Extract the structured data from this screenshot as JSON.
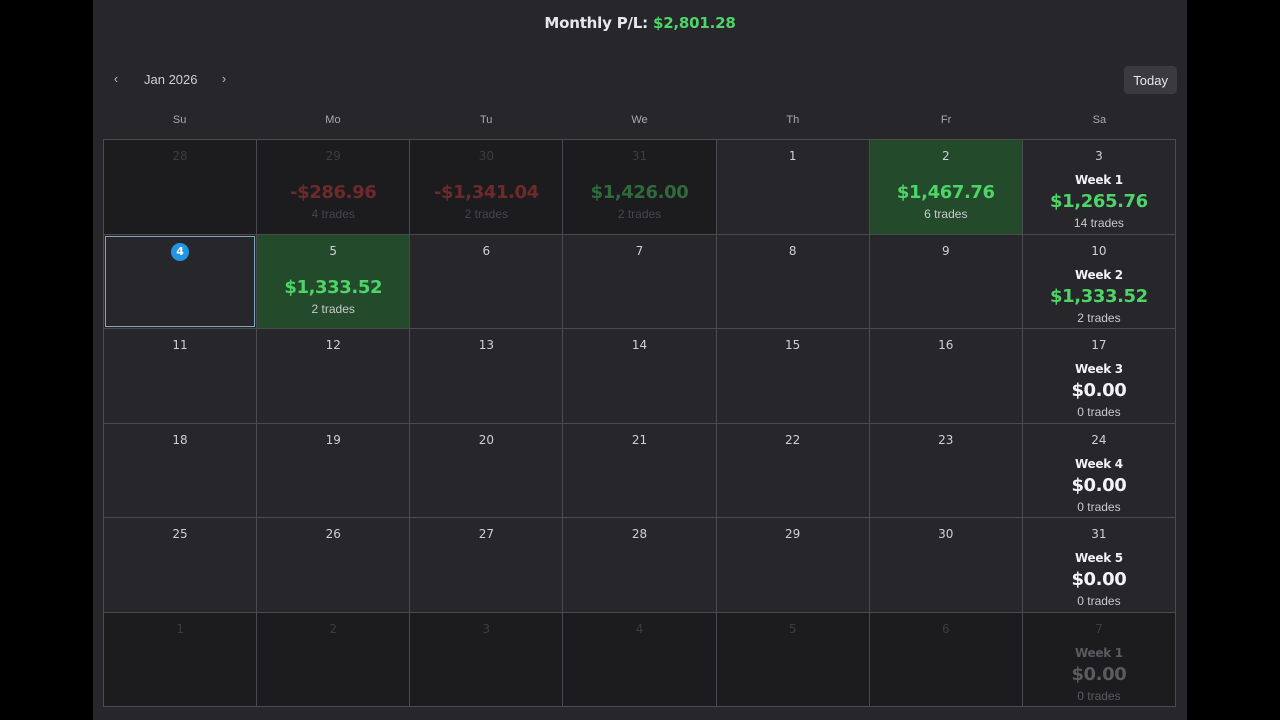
{
  "header": {
    "label": "Monthly P/L:",
    "value": "$2,801.28"
  },
  "nav": {
    "prev": "‹",
    "next": "›",
    "month": "Jan 2026",
    "today": "Today"
  },
  "weekdays": [
    "Su",
    "Mo",
    "Tu",
    "We",
    "Th",
    "Fr",
    "Sa"
  ],
  "weeks": [
    {
      "days": [
        {
          "day": "28",
          "other": true
        },
        {
          "day": "29",
          "other": true,
          "amount": "-$286.96",
          "trades": "4 trades",
          "sign": "neg"
        },
        {
          "day": "30",
          "other": true,
          "amount": "-$1,341.04",
          "trades": "2 trades",
          "sign": "neg"
        },
        {
          "day": "31",
          "other": true,
          "amount": "$1,426.00",
          "trades": "2 trades",
          "sign": "pos"
        },
        {
          "day": "1"
        },
        {
          "day": "2",
          "amount": "$1,467.76",
          "trades": "6 trades",
          "sign": "pos",
          "profit": true
        }
      ],
      "summary": {
        "day": "3",
        "label": "Week 1",
        "amount": "$1,265.76",
        "trades": "14 trades",
        "sign": "pos"
      }
    },
    {
      "days": [
        {
          "day": "4",
          "today": true
        },
        {
          "day": "5",
          "amount": "$1,333.52",
          "trades": "2 trades",
          "sign": "pos",
          "profit": true
        },
        {
          "day": "6"
        },
        {
          "day": "7"
        },
        {
          "day": "8"
        },
        {
          "day": "9"
        }
      ],
      "summary": {
        "day": "10",
        "label": "Week 2",
        "amount": "$1,333.52",
        "trades": "2 trades",
        "sign": "pos"
      }
    },
    {
      "days": [
        {
          "day": "11"
        },
        {
          "day": "12"
        },
        {
          "day": "13"
        },
        {
          "day": "14"
        },
        {
          "day": "15"
        },
        {
          "day": "16"
        }
      ],
      "summary": {
        "day": "17",
        "label": "Week 3",
        "amount": "$0.00",
        "trades": "0 trades",
        "sign": "zero"
      }
    },
    {
      "days": [
        {
          "day": "18"
        },
        {
          "day": "19"
        },
        {
          "day": "20"
        },
        {
          "day": "21"
        },
        {
          "day": "22"
        },
        {
          "day": "23"
        }
      ],
      "summary": {
        "day": "24",
        "label": "Week 4",
        "amount": "$0.00",
        "trades": "0 trades",
        "sign": "zero"
      }
    },
    {
      "days": [
        {
          "day": "25"
        },
        {
          "day": "26"
        },
        {
          "day": "27"
        },
        {
          "day": "28"
        },
        {
          "day": "29"
        },
        {
          "day": "30"
        }
      ],
      "summary": {
        "day": "31",
        "label": "Week 5",
        "amount": "$0.00",
        "trades": "0 trades",
        "sign": "zero"
      }
    },
    {
      "days": [
        {
          "day": "1",
          "other": true
        },
        {
          "day": "2",
          "other": true
        },
        {
          "day": "3",
          "other": true
        },
        {
          "day": "4",
          "other": true
        },
        {
          "day": "5",
          "other": true
        },
        {
          "day": "6",
          "other": true
        }
      ],
      "summary": {
        "day": "7",
        "other": true,
        "label": "Week 1",
        "amount": "$0.00",
        "trades": "0 trades",
        "sign": "zero"
      }
    }
  ],
  "colors": {
    "profit": "#4ed468",
    "loss": "#e05050",
    "accent": "#2196e0",
    "background": "#26262b"
  }
}
